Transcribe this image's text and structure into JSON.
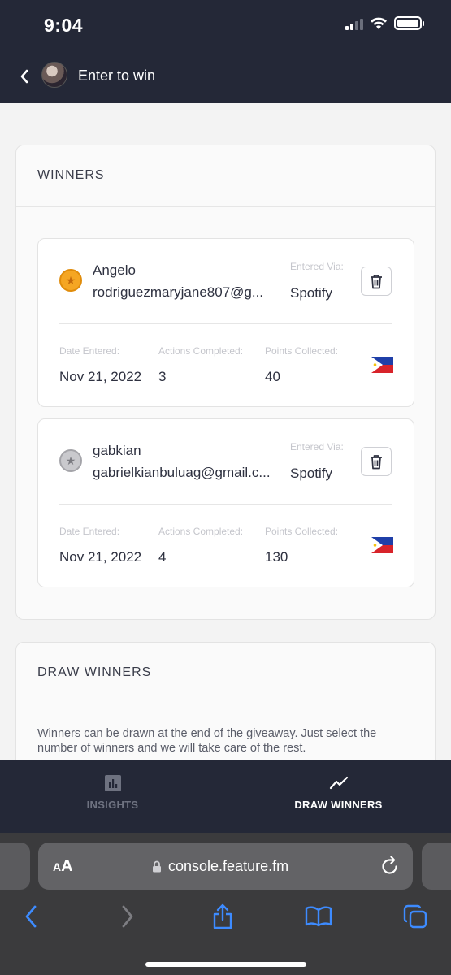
{
  "status_bar": {
    "time": "9:04"
  },
  "nav": {
    "title": "Enter to win"
  },
  "winners_section": {
    "title": "WINNERS",
    "labels": {
      "entered_via": "Entered Via:",
      "date_entered": "Date Entered:",
      "actions_completed": "Actions Completed:",
      "points_collected": "Points Collected:"
    },
    "items": [
      {
        "name": "Angelo",
        "email": "rodriguezmaryjane807@g...",
        "entered_via": "Spotify",
        "date": "Nov 21, 2022",
        "actions": "3",
        "points": "40",
        "star": "gold"
      },
      {
        "name": "gabkian",
        "email": "gabrielkianbuluag@gmail.c...",
        "entered_via": "Spotify",
        "date": "Nov 21, 2022",
        "actions": "4",
        "points": "130",
        "star": "grey"
      }
    ]
  },
  "draw_section": {
    "title": "DRAW WINNERS",
    "description": "Winners can be drawn at the end of the giveaway. Just select the number of winners and we will take care of the rest."
  },
  "tabbar": {
    "insights_label": "INSIGHTS",
    "draw_label": "DRAW WINNERS",
    "active": "draw-winners"
  },
  "browser": {
    "aa_label_small": "A",
    "aa_label_big": "A",
    "url": "console.feature.fm"
  },
  "colors": {
    "header_bg": "#242837",
    "star_gold": "#f5a623",
    "star_grey": "#c9c9cd"
  }
}
